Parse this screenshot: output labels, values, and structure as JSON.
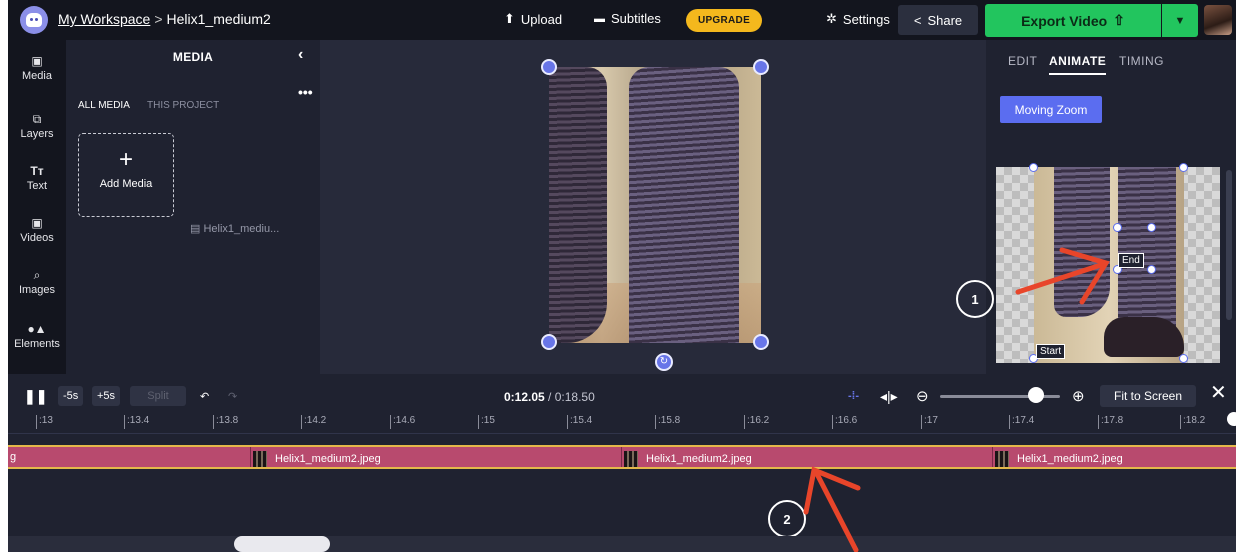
{
  "header": {
    "workspace": "My Workspace",
    "separator": ">",
    "project": "Helix1_medium2",
    "upload": "Upload",
    "subtitles": "Subtitles",
    "upgrade": "UPGRADE",
    "settings": "Settings",
    "share": "Share",
    "export": "Export Video"
  },
  "rail": {
    "items": [
      {
        "label": "Media",
        "icon": "media-icon"
      },
      {
        "label": "Layers",
        "icon": "layers-icon"
      },
      {
        "label": "Text",
        "icon": "text-icon"
      },
      {
        "label": "Videos",
        "icon": "videos-icon"
      },
      {
        "label": "Images",
        "icon": "images-icon"
      },
      {
        "label": "Elements",
        "icon": "elements-icon"
      }
    ]
  },
  "media": {
    "title": "MEDIA",
    "tab_all": "ALL MEDIA",
    "tab_project": "THIS PROJECT",
    "add_label": "Add Media",
    "file_name": "Helix1_mediu..."
  },
  "right_panel": {
    "tabs": [
      "EDIT",
      "ANIMATE",
      "TIMING"
    ],
    "active_tab": "ANIMATE",
    "moving_zoom": "Moving Zoom",
    "end_tag": "End",
    "start_tag": "Start",
    "annotation_1": "1"
  },
  "timeline": {
    "back": "-5s",
    "forward": "+5s",
    "split": "Split",
    "current_time": "0:12.05",
    "total_time": "/ 0:18.50",
    "fit": "Fit to Screen",
    "zoom_level": 0.8,
    "ticks": [
      ":13",
      ":13.4",
      ":13.8",
      ":14.2",
      ":14.6",
      ":15",
      ":15.4",
      ":15.8",
      ":16.2",
      ":16.6",
      ":17",
      ":17.4",
      ":17.8",
      ":18.2"
    ],
    "clips": [
      "Helix1_medium2.jpeg",
      "Helix1_medium2.jpeg",
      "Helix1_medium2.jpeg"
    ],
    "clip_edge_label": "g",
    "annotation_2": "2"
  },
  "colors": {
    "accent": "#5b6df0",
    "export": "#22c55e",
    "upgrade": "#f4b81d",
    "track": "#b84a6e",
    "annotation_arrow": "#e8452a"
  }
}
